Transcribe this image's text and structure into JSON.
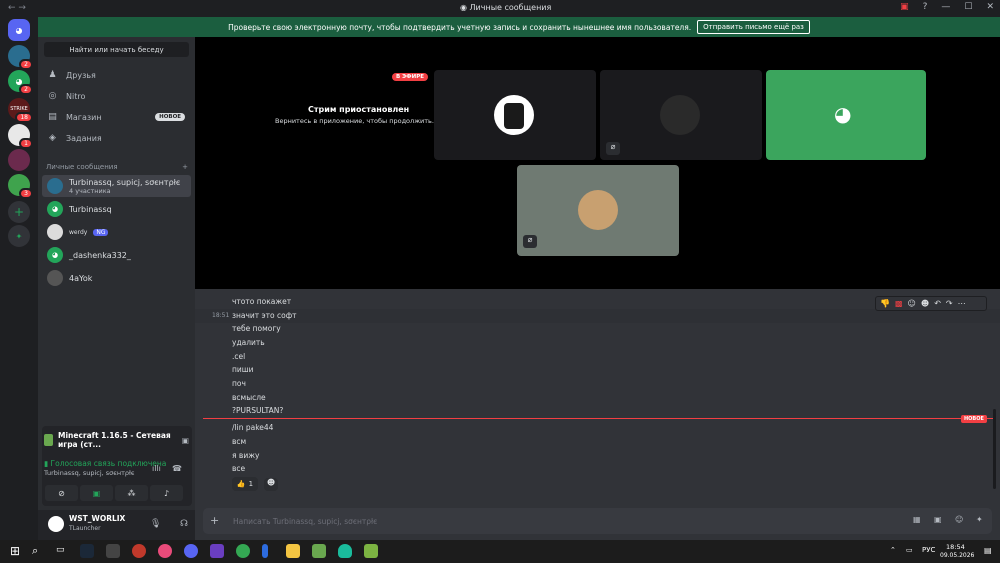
{
  "window": {
    "title": "Личные сообщения",
    "nav": "← →"
  },
  "notice": {
    "text": "Проверьте свою электронную почту, чтобы подтвердить учетную запись и сохранить нынешнее имя пользователя.",
    "button": "Отправить письмо ещё раз"
  },
  "servers": [
    {
      "label": "",
      "badge": ""
    },
    {
      "label": "",
      "badge": "2"
    },
    {
      "label": "",
      "badge": "2"
    },
    {
      "label": "STRIKE",
      "badge": "18"
    },
    {
      "label": "",
      "badge": "1"
    },
    {
      "label": "",
      "badge": ""
    },
    {
      "label": "",
      "badge": "3"
    }
  ],
  "sidebar": {
    "search": "Найти или начать беседу",
    "nav": [
      {
        "label": "Друзья",
        "icon": "friends-icon"
      },
      {
        "label": "Nitro",
        "icon": "nitro-icon"
      },
      {
        "label": "Магазин",
        "icon": "shop-icon",
        "badge": "НОВОЕ"
      },
      {
        "label": "Задания",
        "icon": "quests-icon"
      }
    ],
    "dm_header": "Личные сообщения",
    "dm_add": "+",
    "dms": [
      {
        "name": "Turbinassq, supicj, ѕσєнтρłє",
        "sub": "4 участника"
      },
      {
        "name": "Turbinassq",
        "sub": ""
      },
      {
        "name": "wеrdy",
        "tag": "NG"
      },
      {
        "name": "_dashenka332_",
        "sub": ""
      },
      {
        "name": "4aYok",
        "sub": ""
      }
    ]
  },
  "voice": {
    "game": "Minecraft 1.16.5 - Сетевая игра (ст...",
    "status": "Голосовая связь подключена",
    "channel": "Turbinassq, supicj, ѕσєнтρłє"
  },
  "user": {
    "name": "WST_WORLIX",
    "status": "TLauncher"
  },
  "stream": {
    "live": "В ЭФИРЕ",
    "paused_title": "Стрим приостановлен",
    "paused_sub": "Вернитесь в приложение, чтобы продолжить."
  },
  "chat": {
    "timestamp": "18:51",
    "messages_before": [
      "чтото покажет",
      "значит это софт",
      "тебе помогу",
      "удалить",
      ".cel",
      "пиши",
      "поч",
      "всмысле",
      "?PURSULTAN?"
    ],
    "new_label": "НОВОЕ",
    "messages_after": [
      "/lin pake44",
      "всм",
      "я вижу",
      "все"
    ],
    "reaction_count": "1",
    "placeholder": "Написать Turbinassq, supicj, ѕσєнтρłє"
  },
  "taskbar": {
    "lang": "РУС",
    "time": "18:54",
    "date": "09.05.2026"
  }
}
